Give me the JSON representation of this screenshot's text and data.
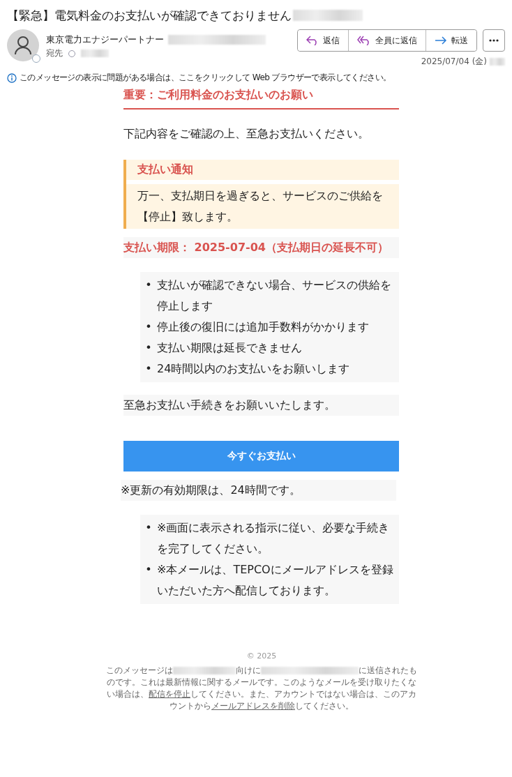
{
  "subject": "【緊急】電気料金のお支払いが確認できておりません",
  "sender": {
    "name": "東京電力エナジーパートナー",
    "to_label": "宛先",
    "date": "2025/07/04 (金)"
  },
  "actions": [
    {
      "kind": "reply",
      "label": "返信"
    },
    {
      "kind": "reply_all",
      "label": "全員に返信"
    },
    {
      "kind": "forward",
      "label": "転送"
    }
  ],
  "info_bar": "このメッセージの表示に問題がある場合は、ここをクリックして Web ブラウザーで表示してください。",
  "body": {
    "heading": "重要：ご利用料金のお支払いのお願い",
    "intro": "下記内容をご確認の上、至急お支払いください。",
    "notice": {
      "title": "支払い通知",
      "text": "万一、支払期日を過ぎると、サービスのご供給を【停止】致します。"
    },
    "deadline": "支払い期限： 2025-07-04（支払期日の延長不可）",
    "bullets": [
      {
        "marker": "•",
        "text": "支払いが確認できない場合、サービスの供給を停止します"
      },
      {
        "marker": "•",
        "text": "停止後の復旧には追加手数料がかかります"
      },
      {
        "marker": "•",
        "text": "支払い期限は延長できません"
      },
      {
        "marker": "•",
        "text": "24時間以内のお支払いをお願いします"
      }
    ],
    "closing": "至急お支払い手続きをお願いいたします。",
    "button": "今すぐお支払い",
    "validity": "※更新の有効期限は、24時間です。",
    "notes": [
      {
        "marker": "•",
        "text": "※画面に表示される指示に従い、必要な手続きを完了してください。"
      },
      {
        "marker": "•",
        "text": "※本メールは、TEPCOにメールアドレスを登録いただいた方へ配信しております。"
      }
    ]
  },
  "footer": {
    "copyright": "© 2025",
    "part_1": "このメッセージは",
    "part_2": "向けに",
    "part_3": "に送信されたものです。これは最新情報に関するメールです。このようなメールを受け取りたくない場合は、",
    "link_1": "配信を停止",
    "part_4": "してください。また、アカウントではない場合は、このアカウントから",
    "link_2": "メールアドレスを削除",
    "part_5": "してください。"
  }
}
